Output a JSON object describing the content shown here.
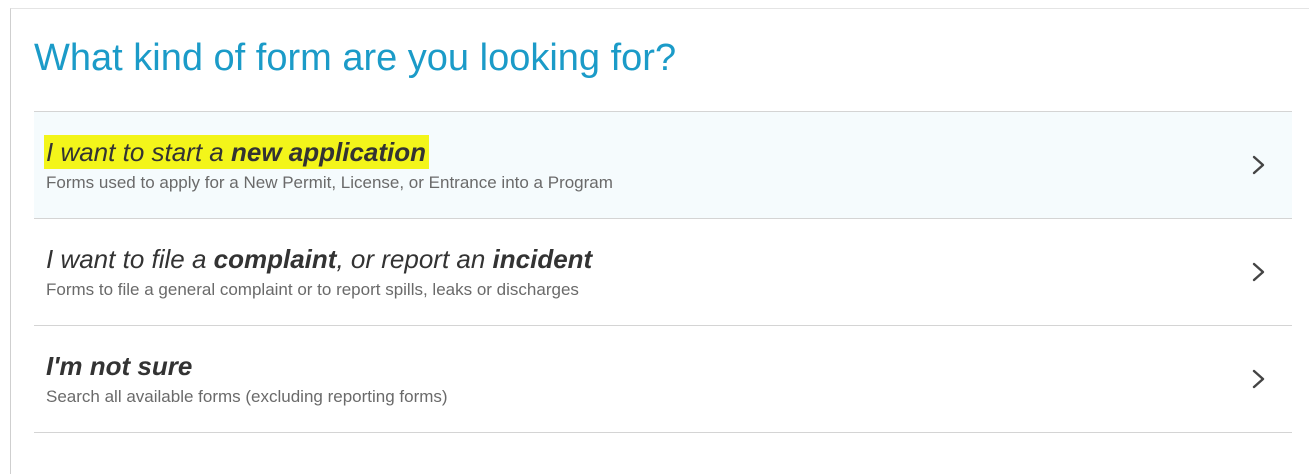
{
  "header": {
    "title": "What kind of form are you looking for?"
  },
  "options": [
    {
      "title_parts": [
        "I want to start a ",
        "new application"
      ],
      "description": "Forms used to apply for a New Permit, License, or Entrance into a Program",
      "icon": "chevron-right-icon",
      "highlight_color": "#f3f51a"
    },
    {
      "title_parts": [
        "I want to file a ",
        "complaint",
        ", or report an ",
        "incident"
      ],
      "description": "Forms to file a general complaint or to report spills, leaks or discharges",
      "icon": "chevron-right-icon"
    },
    {
      "title_parts": [
        "I'm not sure"
      ],
      "description": "Search all available forms (excluding reporting forms)",
      "icon": "chevron-right-icon"
    }
  ],
  "colors": {
    "title": "#1b9bc8",
    "text": "#333333",
    "subtext": "#6a6a6a",
    "divider": "#d4d4d4"
  }
}
